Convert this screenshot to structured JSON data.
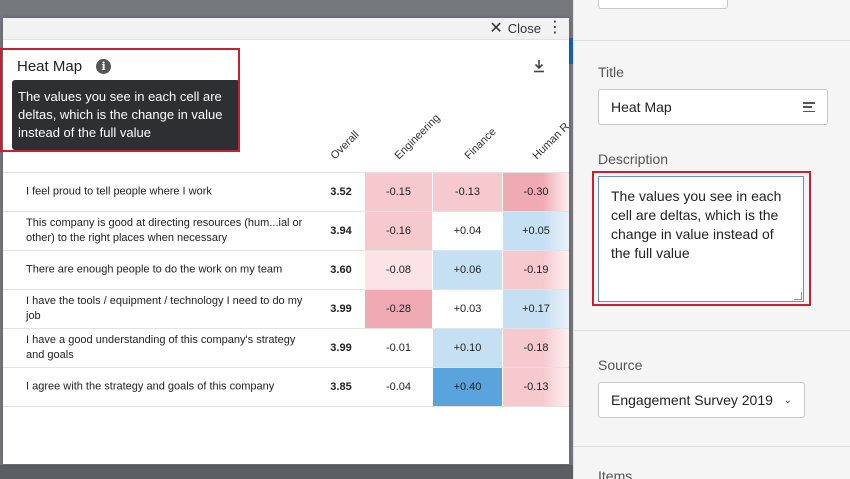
{
  "modal": {
    "close_label": "Close",
    "kebab": "⋮",
    "widget_title": "Heat Map",
    "tooltip": "The values you see in each cell are deltas, which is the change in value instead of the full value"
  },
  "heatmap": {
    "columns": [
      "Overall",
      "Engineering",
      "Finance",
      "Human R"
    ],
    "rows": [
      {
        "question": "I feel proud to tell people where I work",
        "overall": "3.52",
        "cells": [
          "-0.15",
          "-0.13",
          "-0.30"
        ]
      },
      {
        "question": "This company is good at directing resources (hum...ial or other) to the right places when necessary",
        "overall": "3.94",
        "cells": [
          "-0.16",
          "+0.04",
          "+0.05"
        ]
      },
      {
        "question": "There are enough people to do the work on my team",
        "overall": "3.60",
        "cells": [
          "-0.08",
          "+0.06",
          "-0.19"
        ]
      },
      {
        "question": "I have the tools / equipment / technology I need to do my job",
        "overall": "3.99",
        "cells": [
          "-0.28",
          "+0.03",
          "+0.17"
        ]
      },
      {
        "question": "I have a good understanding of this company's strategy and goals",
        "overall": "3.99",
        "cells": [
          "-0.01",
          "+0.10",
          "-0.18"
        ]
      },
      {
        "question": "I agree with the strategy and goals of this company",
        "overall": "3.85",
        "cells": [
          "-0.04",
          "+0.40",
          "-0.13"
        ]
      }
    ],
    "colors": {
      "neg_light": "#fbe3e6",
      "neg_mid": "#f6c9cf",
      "neg_strong": "#f0aab4",
      "pos_light": "#d6e8f7",
      "pos_mid": "#c5dff3",
      "pos_strong": "#5aa4dd",
      "neutral": "#ffffff"
    }
  },
  "panel": {
    "title_label": "Title",
    "title_value": "Heat Map",
    "description_label": "Description",
    "description_value": "The values you see in each cell are deltas, which is the change in value instead of the full value",
    "source_label": "Source",
    "source_value": "Engagement Survey 2019",
    "items_label": "Items"
  }
}
